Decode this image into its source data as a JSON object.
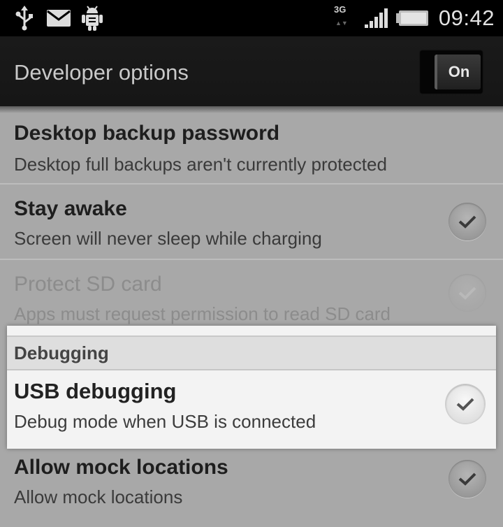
{
  "status_bar": {
    "time": "09:42",
    "network": "3G",
    "icons": [
      "usb-icon",
      "mail-icon",
      "android-debug-icon",
      "signal-icon",
      "battery-icon"
    ]
  },
  "action_bar": {
    "title": "Developer options",
    "toggle_label": "On"
  },
  "settings": [
    {
      "title": "Desktop backup password",
      "summary": "Desktop full backups aren't currently protected"
    },
    {
      "title": "Stay awake",
      "summary": "Screen will never sleep while charging",
      "checked": true
    },
    {
      "title": "Protect SD card",
      "summary": "Apps must request permission to read SD card",
      "checked": true,
      "enabled": false
    }
  ],
  "highlight": {
    "section": "Debugging",
    "title": "USB debugging",
    "summary": "Debug mode when USB is connected",
    "checked": true
  },
  "settings_after": [
    {
      "title": "Allow mock locations",
      "summary": "Allow mock locations",
      "checked": true
    }
  ]
}
